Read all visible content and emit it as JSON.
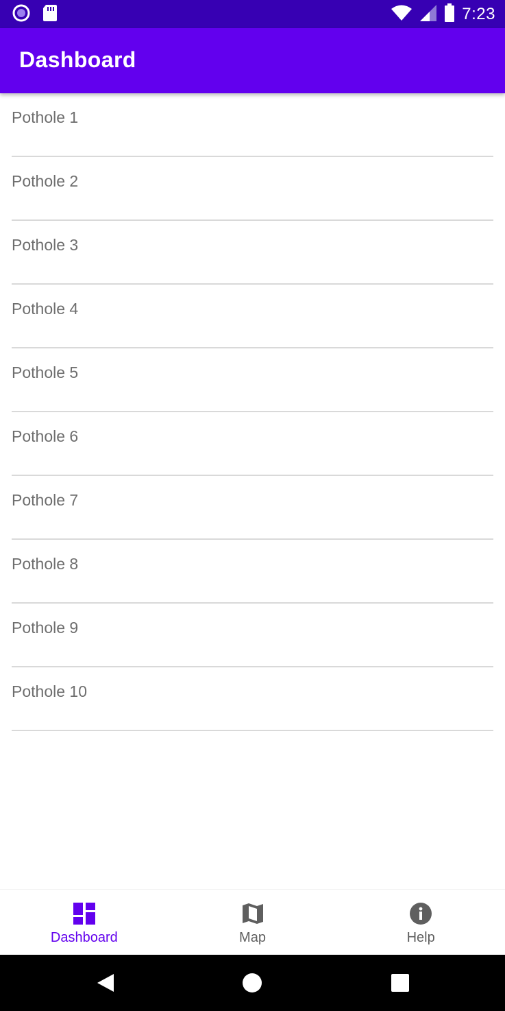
{
  "status_bar": {
    "time": "7:23",
    "icons": [
      "record-icon",
      "sd-card-icon",
      "wifi-icon",
      "signal-icon",
      "battery-icon"
    ]
  },
  "app_bar": {
    "title": "Dashboard"
  },
  "list": {
    "items": [
      {
        "label": "Pothole 1"
      },
      {
        "label": "Pothole 2"
      },
      {
        "label": "Pothole 3"
      },
      {
        "label": "Pothole 4"
      },
      {
        "label": "Pothole 5"
      },
      {
        "label": "Pothole 6"
      },
      {
        "label": "Pothole 7"
      },
      {
        "label": "Pothole 8"
      },
      {
        "label": "Pothole 9"
      },
      {
        "label": "Pothole 10"
      }
    ]
  },
  "bottom_nav": {
    "items": [
      {
        "label": "Dashboard",
        "icon": "dashboard-icon",
        "active": true
      },
      {
        "label": "Map",
        "icon": "map-icon",
        "active": false
      },
      {
        "label": "Help",
        "icon": "info-icon",
        "active": false
      }
    ]
  },
  "system_nav": {
    "buttons": [
      "back-icon",
      "home-icon",
      "recents-icon"
    ]
  },
  "colors": {
    "primary": "#6200ee",
    "primary_dark": "#3700b3",
    "inactive": "#5f5f5f",
    "list_text": "#6e6e6e",
    "divider": "#d9d9d9"
  }
}
